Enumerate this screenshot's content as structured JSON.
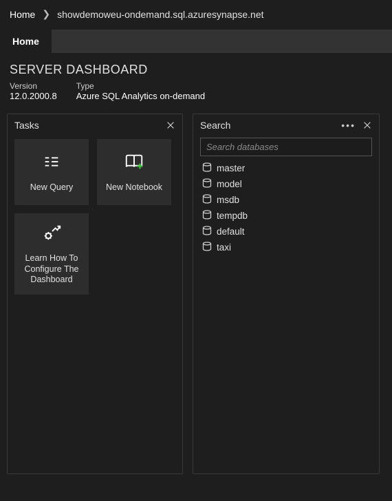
{
  "breadcrumb": {
    "home": "Home",
    "current": "showdemoweu-ondemand.sql.azuresynapse.net"
  },
  "tabs": {
    "home": "Home"
  },
  "header": {
    "title": "SERVER DASHBOARD",
    "version_label": "Version",
    "version_value": "12.0.2000.8",
    "type_label": "Type",
    "type_value": "Azure SQL Analytics on-demand"
  },
  "tasks": {
    "title": "Tasks",
    "items": [
      {
        "label": "New Query"
      },
      {
        "label": "New Notebook"
      },
      {
        "label": "Learn How To Configure The Dashboard"
      }
    ]
  },
  "search": {
    "title": "Search",
    "placeholder": "Search databases",
    "value": "",
    "databases": [
      {
        "name": "master"
      },
      {
        "name": "model"
      },
      {
        "name": "msdb"
      },
      {
        "name": "tempdb"
      },
      {
        "name": "default"
      },
      {
        "name": "taxi"
      }
    ]
  }
}
